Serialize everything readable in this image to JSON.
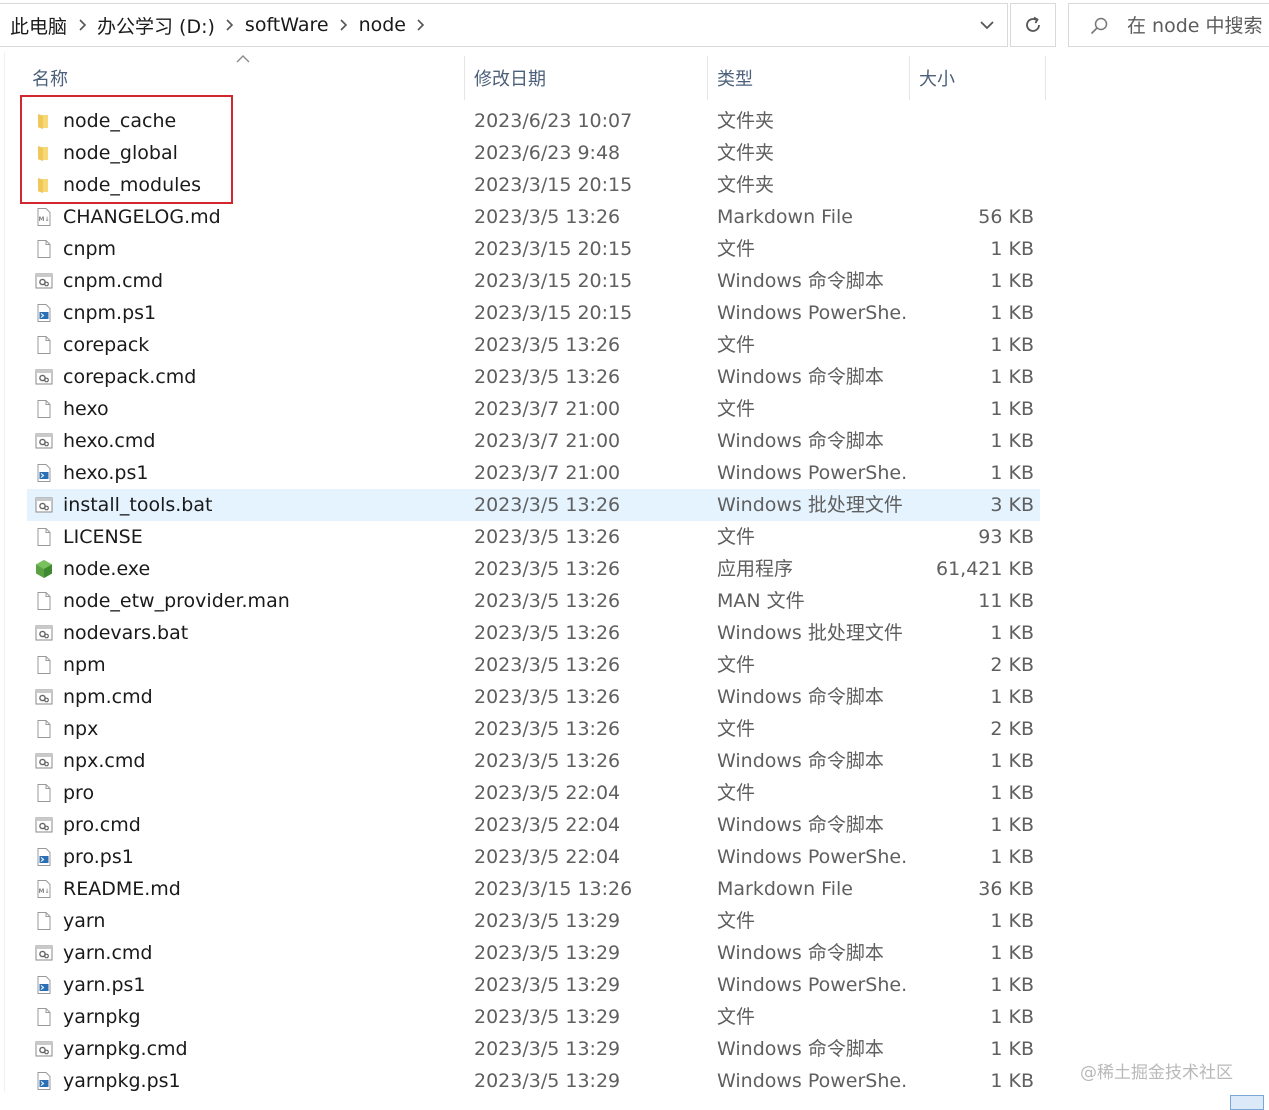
{
  "breadcrumb": [
    "此电脑",
    "办公学习 (D:)",
    "softWare",
    "node"
  ],
  "search": {
    "placeholder": "在 node 中搜索"
  },
  "columns": {
    "name": "名称",
    "date": "修改日期",
    "type": "类型",
    "size": "大小"
  },
  "files": [
    {
      "name": "node_cache",
      "date": "2023/6/23 10:07",
      "type": "文件夹",
      "size": "",
      "icon": "folder-icon"
    },
    {
      "name": "node_global",
      "date": "2023/6/23 9:48",
      "type": "文件夹",
      "size": "",
      "icon": "folder-icon"
    },
    {
      "name": "node_modules",
      "date": "2023/3/15 20:15",
      "type": "文件夹",
      "size": "",
      "icon": "folder-icon"
    },
    {
      "name": "CHANGELOG.md",
      "date": "2023/3/5 13:26",
      "type": "Markdown File",
      "size": "56 KB",
      "icon": "markdown-file-icon"
    },
    {
      "name": "cnpm",
      "date": "2023/3/15 20:15",
      "type": "文件",
      "size": "1 KB",
      "icon": "file-icon"
    },
    {
      "name": "cnpm.cmd",
      "date": "2023/3/15 20:15",
      "type": "Windows 命令脚本",
      "size": "1 KB",
      "icon": "script-file-icon"
    },
    {
      "name": "cnpm.ps1",
      "date": "2023/3/15 20:15",
      "type": "Windows PowerShe...",
      "size": "1 KB",
      "icon": "powershell-file-icon"
    },
    {
      "name": "corepack",
      "date": "2023/3/5 13:26",
      "type": "文件",
      "size": "1 KB",
      "icon": "file-icon"
    },
    {
      "name": "corepack.cmd",
      "date": "2023/3/5 13:26",
      "type": "Windows 命令脚本",
      "size": "1 KB",
      "icon": "script-file-icon"
    },
    {
      "name": "hexo",
      "date": "2023/3/7 21:00",
      "type": "文件",
      "size": "1 KB",
      "icon": "file-icon"
    },
    {
      "name": "hexo.cmd",
      "date": "2023/3/7 21:00",
      "type": "Windows 命令脚本",
      "size": "1 KB",
      "icon": "script-file-icon"
    },
    {
      "name": "hexo.ps1",
      "date": "2023/3/7 21:00",
      "type": "Windows PowerShe...",
      "size": "1 KB",
      "icon": "powershell-file-icon"
    },
    {
      "name": "install_tools.bat",
      "date": "2023/3/5 13:26",
      "type": "Windows 批处理文件",
      "size": "3 KB",
      "icon": "script-file-icon",
      "selected": true
    },
    {
      "name": "LICENSE",
      "date": "2023/3/5 13:26",
      "type": "文件",
      "size": "93 KB",
      "icon": "file-icon"
    },
    {
      "name": "node.exe",
      "date": "2023/3/5 13:26",
      "type": "应用程序",
      "size": "61,421 KB",
      "icon": "nodejs-app-icon"
    },
    {
      "name": "node_etw_provider.man",
      "date": "2023/3/5 13:26",
      "type": "MAN 文件",
      "size": "11 KB",
      "icon": "file-icon"
    },
    {
      "name": "nodevars.bat",
      "date": "2023/3/5 13:26",
      "type": "Windows 批处理文件",
      "size": "1 KB",
      "icon": "script-file-icon"
    },
    {
      "name": "npm",
      "date": "2023/3/5 13:26",
      "type": "文件",
      "size": "2 KB",
      "icon": "file-icon"
    },
    {
      "name": "npm.cmd",
      "date": "2023/3/5 13:26",
      "type": "Windows 命令脚本",
      "size": "1 KB",
      "icon": "script-file-icon"
    },
    {
      "name": "npx",
      "date": "2023/3/5 13:26",
      "type": "文件",
      "size": "2 KB",
      "icon": "file-icon"
    },
    {
      "name": "npx.cmd",
      "date": "2023/3/5 13:26",
      "type": "Windows 命令脚本",
      "size": "1 KB",
      "icon": "script-file-icon"
    },
    {
      "name": "pro",
      "date": "2023/3/5 22:04",
      "type": "文件",
      "size": "1 KB",
      "icon": "file-icon"
    },
    {
      "name": "pro.cmd",
      "date": "2023/3/5 22:04",
      "type": "Windows 命令脚本",
      "size": "1 KB",
      "icon": "script-file-icon"
    },
    {
      "name": "pro.ps1",
      "date": "2023/3/5 22:04",
      "type": "Windows PowerShe...",
      "size": "1 KB",
      "icon": "powershell-file-icon"
    },
    {
      "name": "README.md",
      "date": "2023/3/15 13:26",
      "type": "Markdown File",
      "size": "36 KB",
      "icon": "markdown-file-icon"
    },
    {
      "name": "yarn",
      "date": "2023/3/5 13:29",
      "type": "文件",
      "size": "1 KB",
      "icon": "file-icon"
    },
    {
      "name": "yarn.cmd",
      "date": "2023/3/5 13:29",
      "type": "Windows 命令脚本",
      "size": "1 KB",
      "icon": "script-file-icon"
    },
    {
      "name": "yarn.ps1",
      "date": "2023/3/5 13:29",
      "type": "Windows PowerShe...",
      "size": "1 KB",
      "icon": "powershell-file-icon"
    },
    {
      "name": "yarnpkg",
      "date": "2023/3/5 13:29",
      "type": "文件",
      "size": "1 KB",
      "icon": "file-icon"
    },
    {
      "name": "yarnpkg.cmd",
      "date": "2023/3/5 13:29",
      "type": "Windows 命令脚本",
      "size": "1 KB",
      "icon": "script-file-icon"
    },
    {
      "name": "yarnpkg.ps1",
      "date": "2023/3/5 13:29",
      "type": "Windows PowerShe...",
      "size": "1 KB",
      "icon": "powershell-file-icon"
    }
  ],
  "watermark": "@稀土掘金技术社区",
  "colors": {
    "selected_row": "#e5f3ff",
    "highlight_box": "#d3272f",
    "header_text": "#4c607a",
    "folder": "#f8d775"
  }
}
